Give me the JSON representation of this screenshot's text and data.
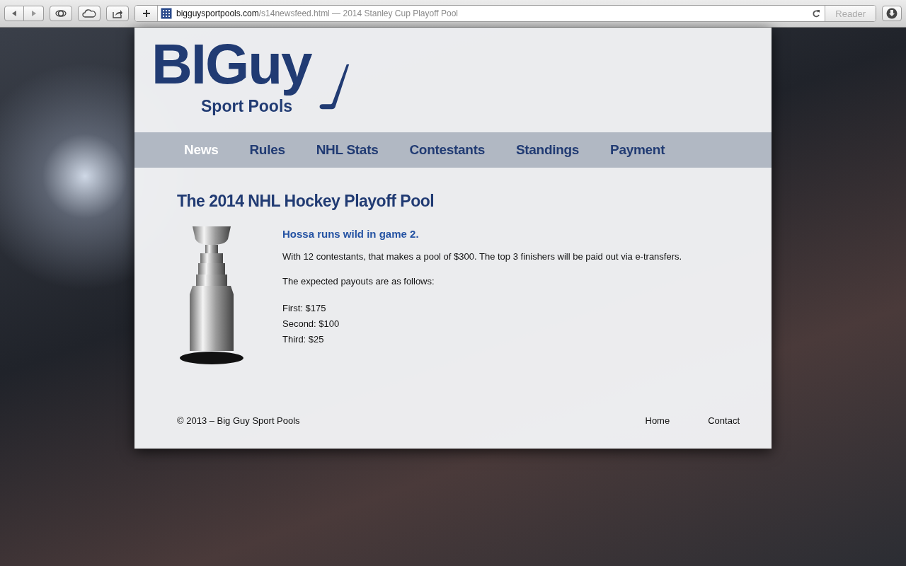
{
  "browser": {
    "url_domain": "bigguysportpools.com",
    "url_rest": "/s14newsfeed.html — 2014 Stanley Cup Playoff Pool",
    "reader_button": "Reader"
  },
  "logo": {
    "wordmark": "BIGuy",
    "tagline": "Sport Pools"
  },
  "nav": [
    {
      "label": "News",
      "selected": true
    },
    {
      "label": "Rules",
      "selected": false
    },
    {
      "label": "NHL Stats",
      "selected": false
    },
    {
      "label": "Contestants",
      "selected": false
    },
    {
      "label": "Standings",
      "selected": false
    },
    {
      "label": "Payment",
      "selected": false
    }
  ],
  "article": {
    "title": "The 2014 NHL Hockey Playoff Pool",
    "headline": "Hossa runs wild in game 2.",
    "paragraphs": [
      "With 12 contestants, that makes a pool of $300. The top 3 finishers will be paid out via e-transfers.",
      "The expected payouts are as follows:"
    ],
    "payouts": [
      "First: $175",
      "Second: $100",
      "Third: $25"
    ]
  },
  "footer": {
    "copyright": "© 2013 – Big Guy Sport Pools",
    "links": [
      "Home",
      "Contact"
    ]
  }
}
